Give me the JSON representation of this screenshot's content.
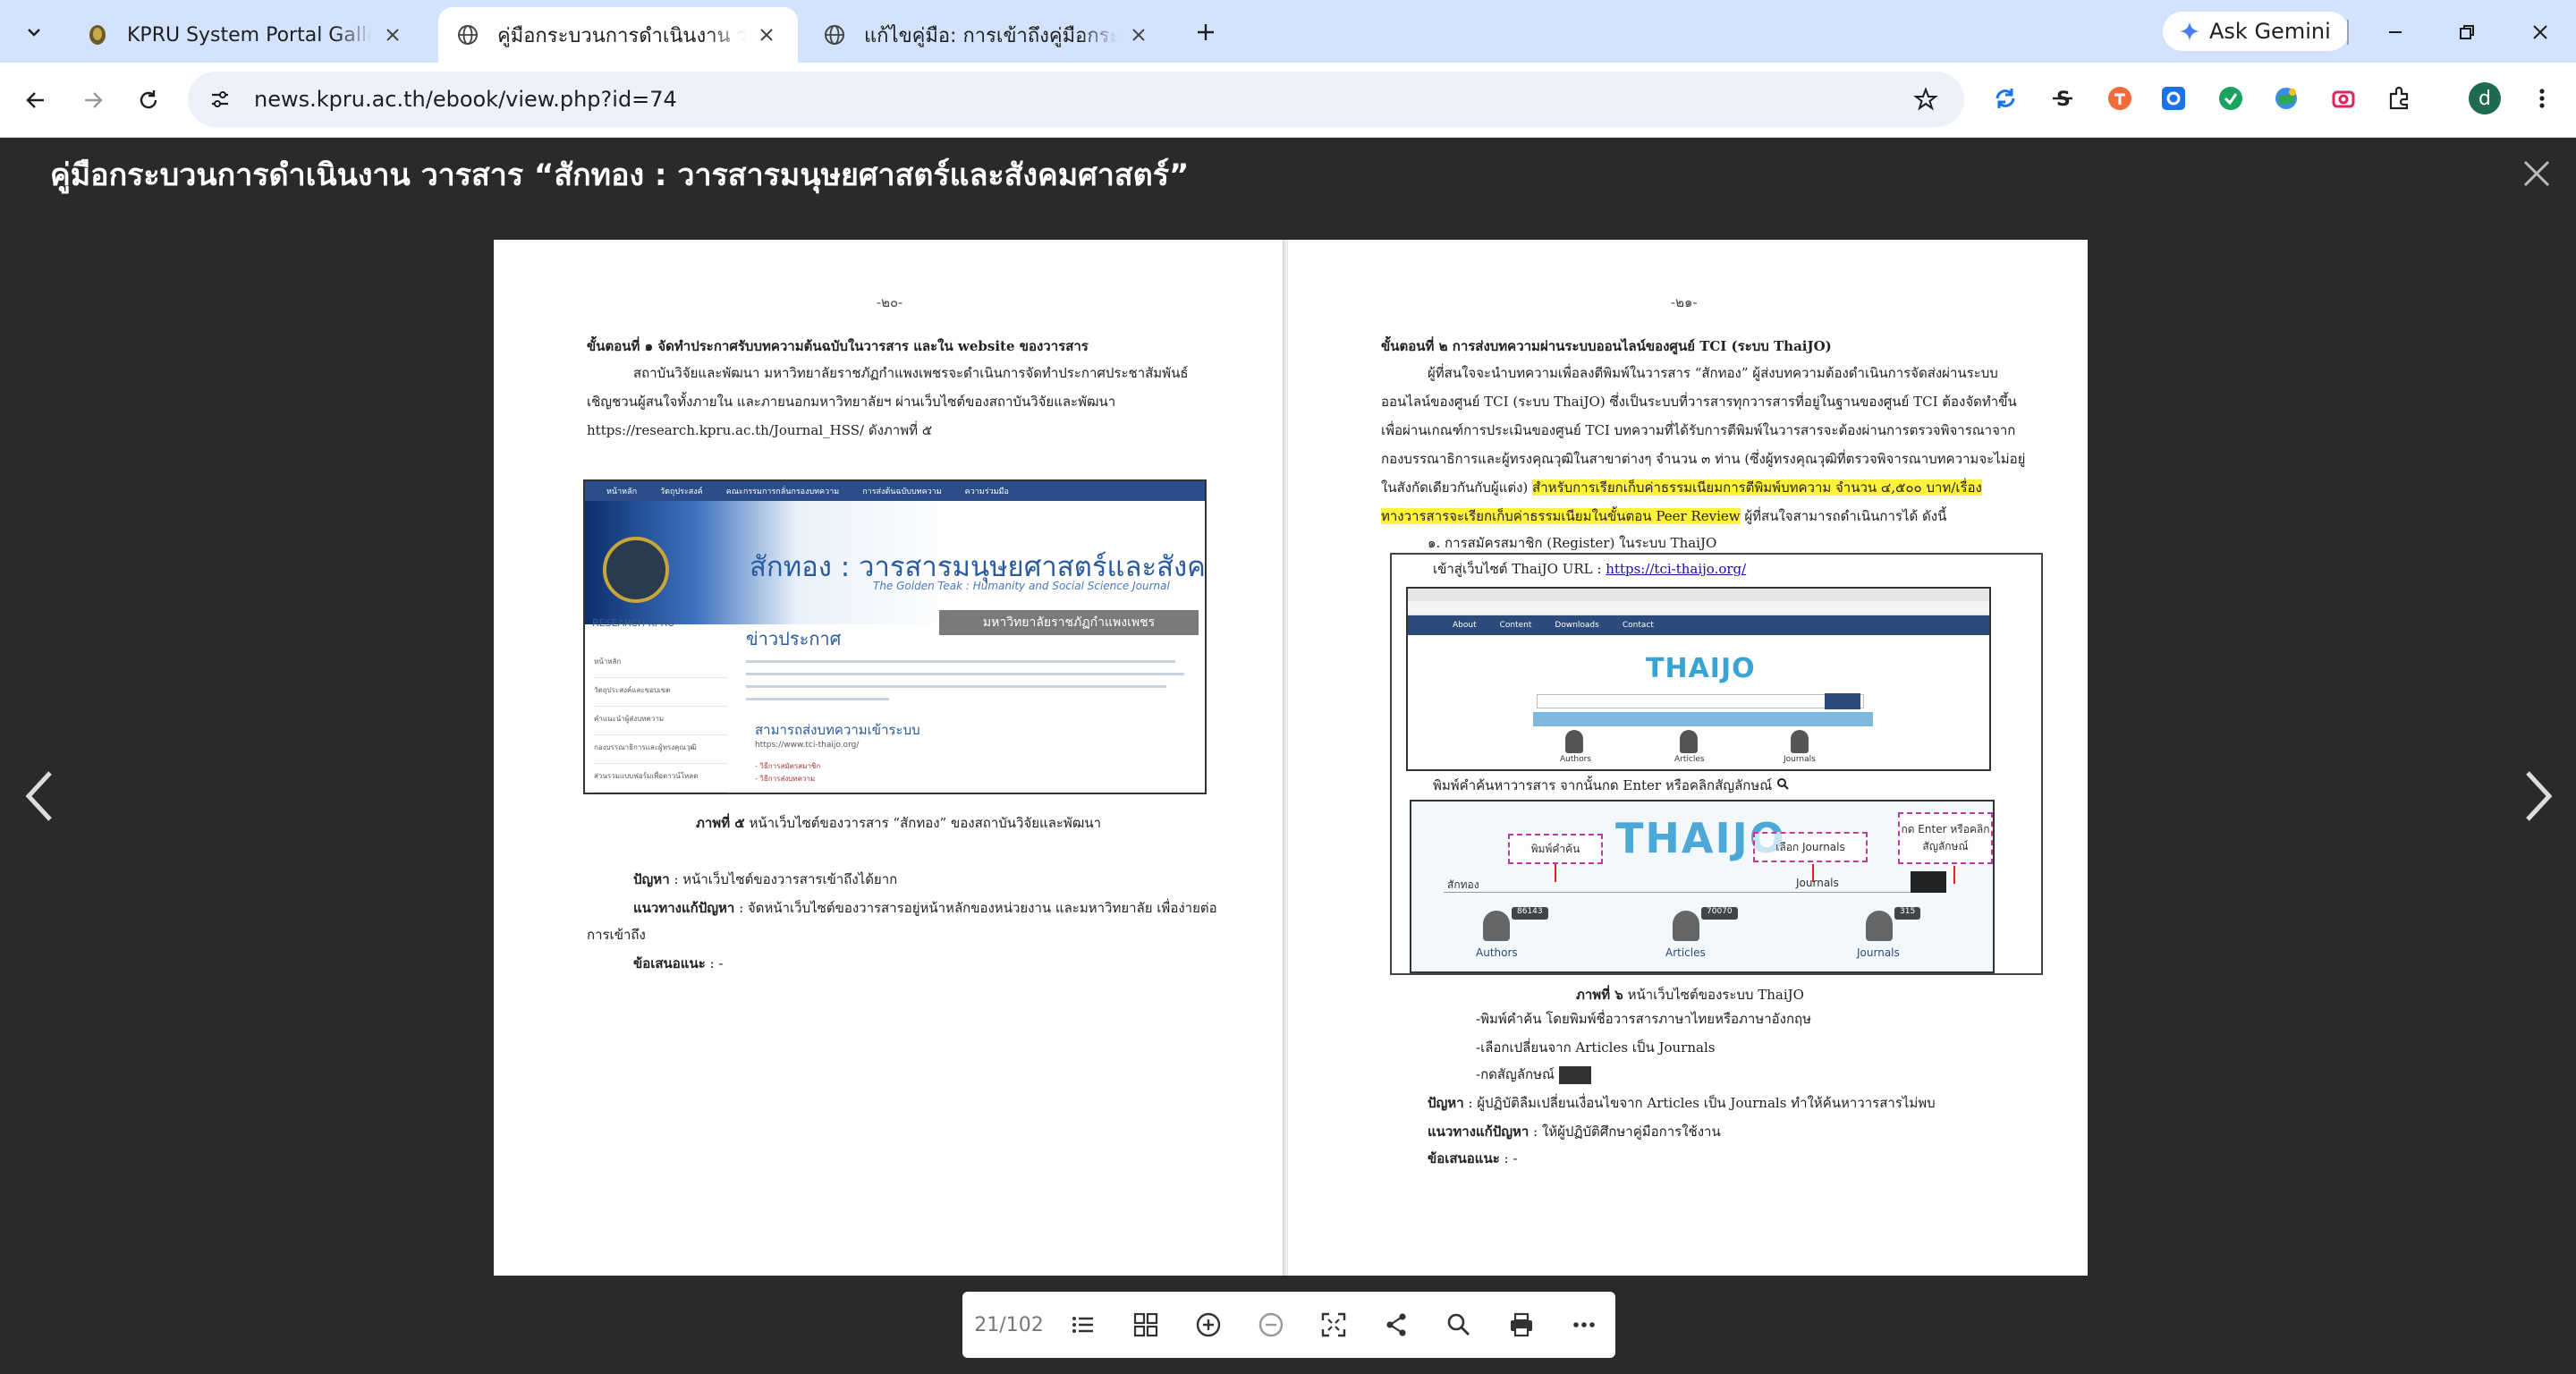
{
  "browser": {
    "tabs": [
      {
        "title": "KPRU System Portal Gallery",
        "active": false
      },
      {
        "title": "คู่มือกระบวนการดำเนินงาน วารสาร “สักทอง",
        "active": true
      },
      {
        "title": "แก้ไขคู่มือ: การเข้าถึงคู่มือกระบวนการ",
        "active": false
      }
    ],
    "ask_gemini": "Ask Gemini",
    "url": "news.kpru.ac.th/ebook/view.php?id=74",
    "profile_initial": "d",
    "accent_color": "#d3e3fd"
  },
  "viewer": {
    "title": "คู่มือกระบวนการดำเนินงาน วารสาร “สักทอง : วารสารมนุษยศาสตร์และสังคมศาสตร์”",
    "page_indicator": "21/102"
  },
  "left_page": {
    "page_number": "-๒๐-",
    "heading": "ขั้นตอนที่ ๑ จัดทำประกาศรับบทความต้นฉบับในวารสาร และใน website ของวารสาร",
    "para_lines": [
      "สถาบันวิจัยและพัฒนา มหาวิทยาลัยราชภัฏกำแพงเพชรจะดำเนินการจัดทำประกาศประชาสัมพันธ์",
      "เชิญชวนผู้สนใจทั้งภายใน และภายนอกมหาวิทยาลัยฯ ผ่านเว็บไซต์ของสถาบันวิจัยและพัฒนา",
      "https://research.kpru.ac.th/Journal_HSS/ ดังภาพที่ ๕"
    ],
    "screenshot": {
      "nav": [
        "หน้าหลัก",
        "วัตถุประสงค์",
        "คณะกรรมการกลั่นกรองบทความ",
        "การส่งต้นฉบับบทความ",
        "ความร่วมมือ"
      ],
      "title": "สักทอง : วารสารมนุษยศาสตร์และสังคมศาสตร์",
      "subtitle": "The Golden Teak : Humanity and Social Science Journal",
      "university": "มหาวิทยาลัยราชภัฏกำแพงเพชร",
      "research": "RESEARCH KPRU",
      "side": [
        "หน้าหลัก",
        "วัตถุประสงค์และขอบเขต",
        "คำแนะนำผู้ส่งบทความ",
        "กองบรรณาธิการและผู้ทรงคุณวุฒิ",
        "ส่วนรวมแบบฟอร์มเพื่อดาวน์โหลด"
      ],
      "news": "ข่าวประกาศ",
      "submit": "สามารถส่งบทความเข้าระบบ",
      "thaijo": "https://www.tci-thaijo.org/",
      "small1": "- วิธีการสมัครสมาชิก",
      "small2": "- วิธีการส่งบทความ"
    },
    "caption_bold": "ภาพที่ ๕",
    "caption_text": " หน้าเว็บไซต์ของวารสาร “สักทอง” ของสถาบันวิจัยและพัฒนา",
    "problem_label": "ปัญหา",
    "problem_text": " : หน้าเว็บไซต์ของวารสารเข้าถึงได้ยาก",
    "solution_label": "แนวทางแก้ปัญหา",
    "solution_text": " : จัดหน้าเว็บไซต์ของวารสารอยู่หน้าหลักของหน่วยงาน และมหาวิทยาลัย เพื่อง่ายต่อ",
    "solution_text2": "การเข้าถึง",
    "suggest_label": "ข้อเสนอแนะ",
    "suggest_text": " : -"
  },
  "right_page": {
    "page_number": "-๒๑-",
    "heading": "ขั้นตอนที่ ๒ การส่งบทความผ่านระบบออนไลน์ของศูนย์ TCI (ระบบ ThaiJO)",
    "para_lines": [
      "ผู้ที่สนใจจะนำบทความเพื่อลงตีพิมพ์ในวารสาร “สักทอง” ผู้ส่งบทความต้องดำเนินการจัดส่งผ่านระบบ",
      "ออนไลน์ของศูนย์ TCI (ระบบ ThaiJO) ซึ่งเป็นระบบที่วารสารทุกวารสารที่อยู่ในฐานของศูนย์ TCI ต้องจัดทำขึ้น",
      "เพื่อผ่านเกณฑ์การประเมินของศูนย์ TCI บทความที่ได้รับการตีพิมพ์ในวารสารจะต้องผ่านการตรวจพิจารณาจาก",
      "กองบรรณาธิการและผู้ทรงคุณวุฒิในสาขาต่างๆ จำนวน ๓ ท่าน (ซึ่งผู้ทรงคุณวุฒิที่ตรวจพิจารณาบทความจะไม่อยู่"
    ],
    "line5_plain": "ในสังกัดเดียวกันกับผู้แต่ง) ",
    "line5_highlight": "สำหรับการเรียกเก็บค่าธรรมเนียมการตีพิมพ์บทความ จำนวน ๔,๕๐๐ บาท/เรื่อง",
    "line6_highlight": "ทางวารสารจะเรียกเก็บค่าธรรมเนียมในขั้นตอน Peer Review",
    "line6_plain": " ผู้ที่สนใจสามารถดำเนินการได้ ดังนี้",
    "step1": "๑. การสมัครสมาชิก (Register) ในระบบ ThaiJO",
    "fig_line1_text": "เข้าสู่เว็บไซต์ ThaiJO URL : ",
    "fig_line1_link": "https://tci-thaijo.org/",
    "shot2": {
      "logo": "THAIJO",
      "nav": [
        "About",
        "Content",
        "Downloads",
        "Contact"
      ],
      "items": [
        "Authors",
        "Articles",
        "Journals"
      ]
    },
    "fig_line2": "พิมพ์คำค้นหาวารสาร จากนั้นกด Enter หรือคลิกสัญลักษณ์",
    "shot3": {
      "logo": "THAIJO",
      "box_keyword": "พิมพ์คำค้น",
      "box_journals": "เลือก Journals",
      "box_enter": "กด Enter หรือคลิก",
      "box_enter2": "สัญลักษณ์",
      "search_value": "สักทอง",
      "dropdown": "Journals",
      "items": [
        {
          "label": "Authors",
          "count": "86143"
        },
        {
          "label": "Articles",
          "count": "70070"
        },
        {
          "label": "Journals",
          "count": "315"
        }
      ]
    },
    "caption_bold": "ภาพที่ ๖",
    "caption_text": " หน้าเว็บไซต์ของระบบ ThaiJO",
    "steps": [
      "-พิมพ์คำค้น โดยพิมพ์ชื่อวารสารภาษาไทยหรือภาษาอังกฤษ",
      "-เลือกเปลี่ยนจาก Articles เป็น Journals",
      "-กดสัญลักษณ์"
    ],
    "problem_label": "ปัญหา",
    "problem_text": " : ผู้ปฏิบัติลืมเปลี่ยนเงื่อนไขจาก Articles เป็น Journals ทำให้ค้นหาวารสารไม่พบ",
    "solution_label": "แนวทางแก้ปัญหา",
    "solution_text": " : ให้ผู้ปฏิบัติศึกษาคู่มือการใช้งาน",
    "suggest_label": "ข้อเสนอแนะ",
    "suggest_text": " : -"
  },
  "icons": {
    "tabs_menu": "chevron-down-icon",
    "back": "back-arrow-icon",
    "forward": "forward-arrow-icon",
    "reload": "reload-icon",
    "bookmark": "star-icon",
    "toc": "list-icon",
    "thumbnails": "grid-icon",
    "zoom_in": "zoom-in-icon",
    "zoom_out": "zoom-out-icon",
    "fullscreen": "fullscreen-icon",
    "share": "share-icon",
    "search": "search-icon",
    "print": "print-icon",
    "more": "more-icon"
  }
}
